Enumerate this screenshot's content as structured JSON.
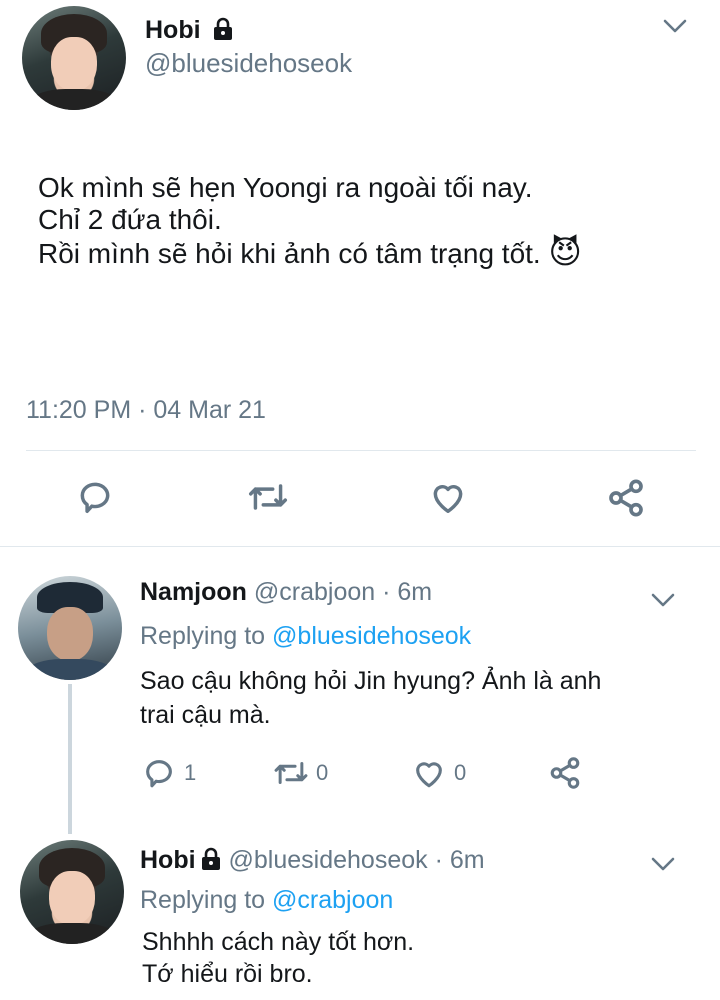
{
  "main_tweet": {
    "author_name": "Hobi",
    "handle": "@bluesidehoseok",
    "lines": [
      "Ok mình sẽ hẹn Yoongi ra ngoài tối nay.",
      "Chỉ 2 đứa thôi.",
      "Rồi mình sẽ hỏi khi ảnh có tâm trạng tốt."
    ],
    "emoji": "😈",
    "timestamp": "11:20 PM · 04 Mar 21"
  },
  "replies": [
    {
      "author_name": "Namjoon",
      "handle_time": "@crabjoon · 6m",
      "replying_prefix": "Replying to",
      "replying_to": "@bluesidehoseok",
      "lines": [
        "Sao cậu không hỏi Jin hyung? Ảnh là anh",
        "trai cậu mà."
      ],
      "reply_count": "1",
      "retweet_count": "0",
      "like_count": "0"
    },
    {
      "author_name": "Hobi",
      "handle_time": "@bluesidehoseok · 6m",
      "replying_prefix": "Replying to",
      "replying_to": "@crabjoon",
      "lines": [
        "Shhhh cách này tốt hơn.",
        "Tớ hiểu rồi bro."
      ]
    }
  ],
  "icons": {
    "reply": "reply-icon",
    "retweet": "retweet-icon",
    "like": "heart-icon",
    "share": "share-icon",
    "lock": "lock-icon",
    "caret": "chevron-down-icon"
  },
  "colors": {
    "link": "#1da1f2",
    "muted": "#657786",
    "divider": "#e1e8ed"
  }
}
